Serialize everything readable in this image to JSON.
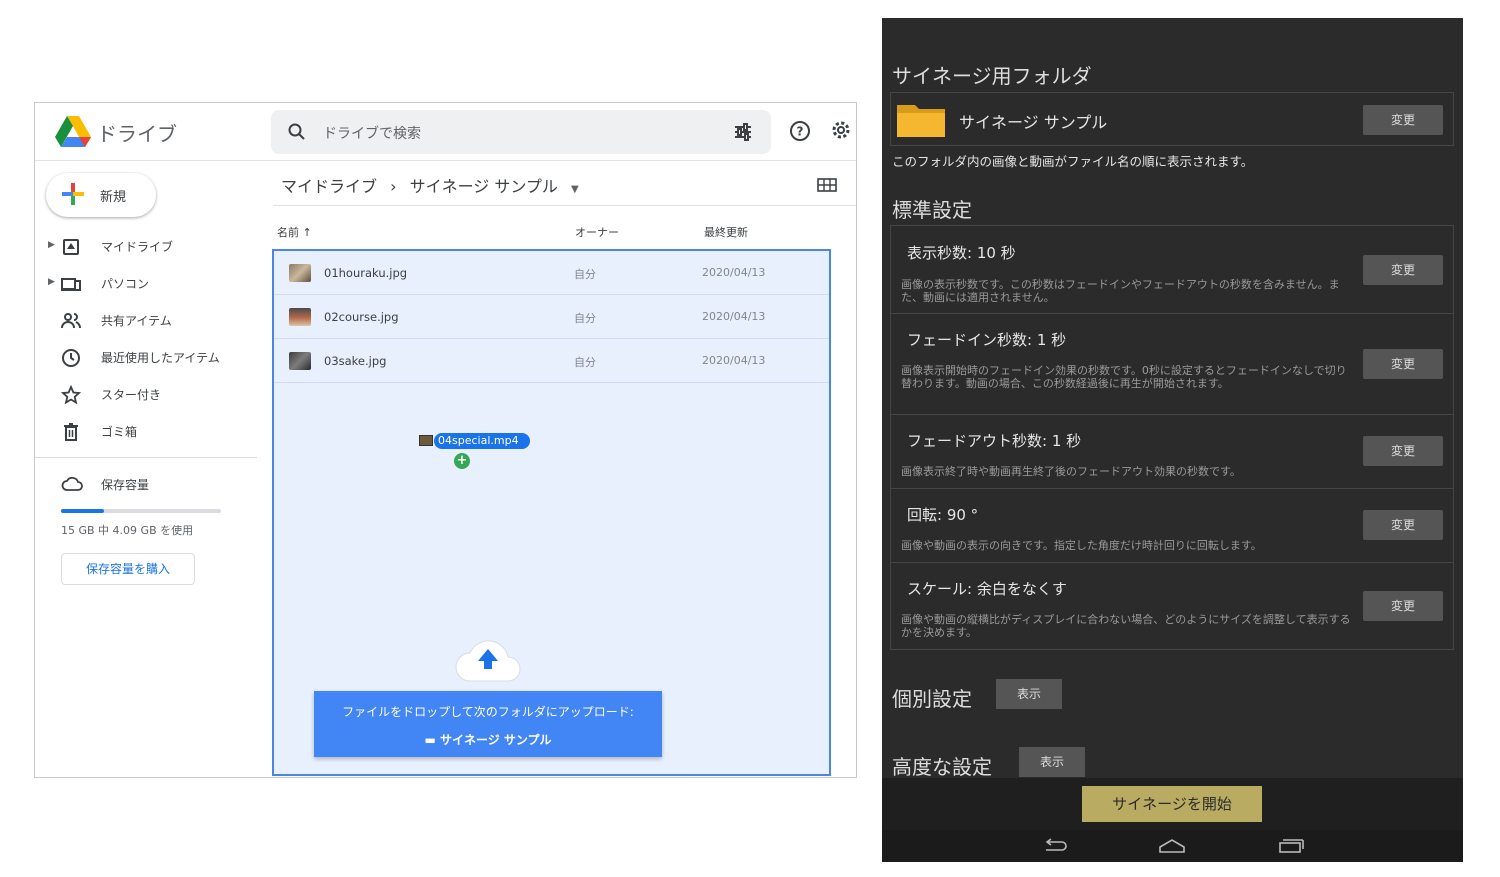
{
  "drive": {
    "app_title": "ドライブ",
    "search_placeholder": "ドライブで検索",
    "new_label": "新規",
    "nav": [
      {
        "label": "マイドライブ",
        "icon": "my-drive-icon"
      },
      {
        "label": "パソコン",
        "icon": "computer-icon"
      },
      {
        "label": "共有アイテム",
        "icon": "shared-icon"
      },
      {
        "label": "最近使用したアイテム",
        "icon": "clock-icon"
      },
      {
        "label": "スター付き",
        "icon": "star-icon"
      },
      {
        "label": "ゴミ箱",
        "icon": "trash-icon"
      }
    ],
    "storage": {
      "label": "保存容量",
      "used_text": "15 GB 中 4.09 GB を使用",
      "used_fraction": 0.27,
      "buy_label": "保存容量を購入"
    },
    "breadcrumb": {
      "root": "マイドライブ",
      "separator": "›",
      "current": "サイネージ サンプル"
    },
    "columns": {
      "name": "名前",
      "owner": "オーナー",
      "modified": "最終更新"
    },
    "files": [
      {
        "name": "01houraku.jpg",
        "owner": "自分",
        "modified": "2020/04/13"
      },
      {
        "name": "02course.jpg",
        "owner": "自分",
        "modified": "2020/04/13"
      },
      {
        "name": "03sake.jpg",
        "owner": "自分",
        "modified": "2020/04/13"
      }
    ],
    "drag_file": "04special.mp4",
    "drop_toast": {
      "line1": "ファイルをドロップして次のフォルダにアップロード:",
      "folder": "サイネージ サンプル"
    },
    "colors": {
      "accent": "#1a73e8",
      "drop_bg": "#e8f0fe",
      "toast": "#4285f4"
    }
  },
  "phone": {
    "folder_heading": "サイネージ用フォルダ",
    "folder_name": "サイネージ サンプル",
    "change_label": "変更",
    "folder_note": "このフォルダ内の画像と動画がファイル名の順に表示されます。",
    "standard_heading": "標準設定",
    "settings": [
      {
        "title": "表示秒数: 10 秒",
        "desc": "画像の表示秒数です。この秒数はフェードインやフェードアウトの秒数を含みません。また、動画には適用されません。"
      },
      {
        "title": "フェードイン秒数: 1 秒",
        "desc": "画像表示開始時のフェードイン効果の秒数です。0秒に設定するとフェードインなしで切り替わります。動画の場合、この秒数経過後に再生が開始されます。"
      },
      {
        "title": "フェードアウト秒数: 1 秒",
        "desc": "画像表示終了時や動画再生終了後のフェードアウト効果の秒数です。"
      },
      {
        "title": "回転: 90 °",
        "desc": "画像や動画の表示の向きです。指定した角度だけ時計回りに回転します。"
      },
      {
        "title": "スケール: 余白をなくす",
        "desc": "画像や動画の縦横比がディスプレイに合わない場合、どのようにサイズを調整して表示するかを決めます。"
      }
    ],
    "individual_heading": "個別設定",
    "advanced_heading": "高度な設定",
    "show_label": "表示",
    "start_label": "サイネージを開始",
    "colors": {
      "bg": "#2b2b2b",
      "start": "#b9ab62"
    }
  }
}
